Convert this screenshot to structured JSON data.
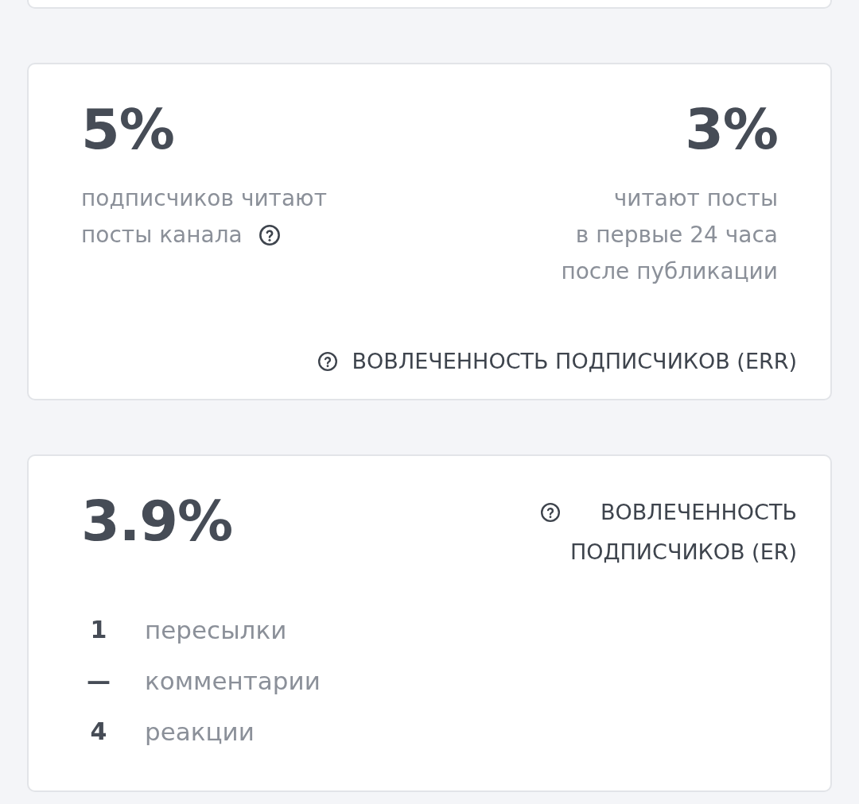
{
  "err_card": {
    "stats": [
      {
        "kind": "share",
        "value": "5%",
        "lines": [
          "подписчиков читают",
          "посты канала"
        ],
        "help": true
      },
      {
        "kind": "early",
        "value": "3%",
        "lines": [
          "читают посты",
          "в первые 24 часа",
          "после публикации"
        ],
        "help": false
      }
    ],
    "footer": "ВОВЛЕЧЕННОСТЬ ПОДПИСЧИКОВ (ERR)"
  },
  "er_card": {
    "value": "3.9%",
    "title": "ВОВЛЕЧЕННОСТЬ\nПОДПИСЧИКОВ (ER)",
    "metrics": [
      {
        "value": "1",
        "label": "пересылки"
      },
      {
        "value": "—",
        "label": "комментарии"
      },
      {
        "value": "4",
        "label": "реакции"
      }
    ]
  }
}
